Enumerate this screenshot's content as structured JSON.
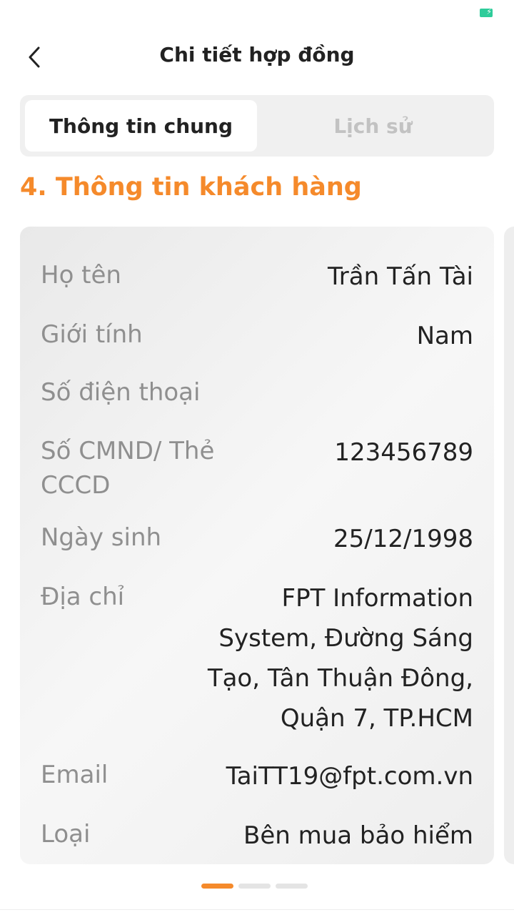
{
  "header": {
    "title": "Chi tiết hợp đồng",
    "back_icon": "chevron-left-icon"
  },
  "tabs": [
    {
      "label": "Thông tin chung",
      "active": true
    },
    {
      "label": "Lịch sử",
      "active": false
    }
  ],
  "section": {
    "title": "4. Thông tin khách hàng"
  },
  "customer": {
    "fields": [
      {
        "label": "Họ tên",
        "value": "Trần Tấn Tài"
      },
      {
        "label": "Giới tính",
        "value": "Nam"
      },
      {
        "label": "Số điện thoại",
        "value": ""
      },
      {
        "label": "Số CMND/ Thẻ CCCD",
        "value": "123456789"
      },
      {
        "label": "Ngày sinh",
        "value": "25/12/1998"
      },
      {
        "label": "Địa chỉ",
        "value": "FPT Information System, Đường Sáng Tạo, Tân Thuận Đông, Quận 7, TP.HCM"
      },
      {
        "label": "Email",
        "value": "TaiTT19@fpt.com.vn"
      },
      {
        "label": "Loại",
        "value": "Bên mua bảo hiểm"
      }
    ]
  },
  "pager": {
    "pages": 3,
    "current": 1
  },
  "colors": {
    "accent": "#f58a2b",
    "battery": "#2ecc9a",
    "label": "#8f8f8f",
    "value": "#222222"
  }
}
